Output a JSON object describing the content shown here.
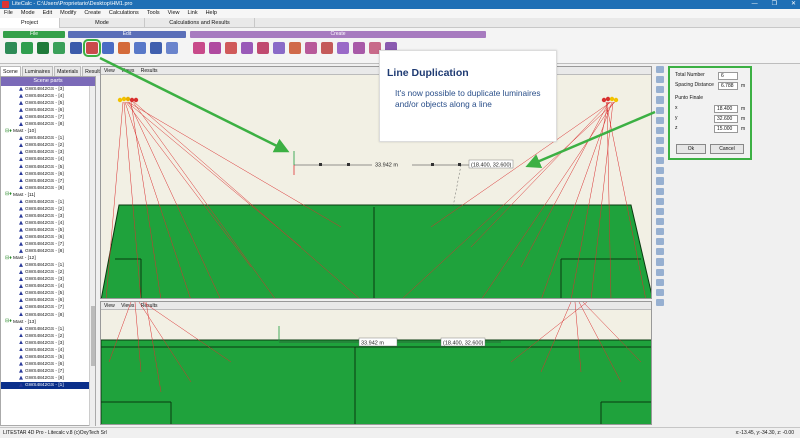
{
  "window": {
    "title": "LiteCalc - C:\\Users\\Proprietario\\Desktop\\HM1.pro",
    "controls": [
      "—",
      "❐",
      "✕"
    ]
  },
  "menu": [
    "File",
    "Mode",
    "Edit",
    "Modify",
    "Create",
    "Calculations",
    "Tools",
    "View",
    "Link",
    "Help"
  ],
  "ribbon_tabs": [
    "Project",
    "Mode",
    "Calculations and Results"
  ],
  "ribbon_groups": {
    "file": "File",
    "edit": "Edit",
    "create": "Create"
  },
  "colors": {
    "file_group": "#34a04a",
    "edit_group": "#5b6fb8",
    "create_group": "#a77bbf",
    "field_green": "#1fa23c",
    "highlight": "#3cb043",
    "callout_text": "#1f3b73"
  },
  "icons": {
    "file": [
      "new-file-icon",
      "open-folder-icon",
      "save-icon",
      "print-icon"
    ],
    "edit": [
      "select-icon",
      "line-duplicate-icon",
      "move-icon",
      "rotate-icon",
      "align-icon",
      "group-icon",
      "ungroup-icon"
    ],
    "create": [
      "luminaire-icon",
      "array-icon",
      "grid-icon",
      "field-icon",
      "mast-icon",
      "light-icon",
      "object-icon",
      "house-icon",
      "calc-grid-icon",
      "sensor-icon",
      "measure-icon",
      "wall-icon",
      "more-icon"
    ]
  },
  "left_tabs": [
    "Scene",
    "Luminaires",
    "Materials",
    "Results"
  ],
  "scene": {
    "header": "Scene parts",
    "items": [
      {
        "type": "lum",
        "label": "GWS4842GS - [3]"
      },
      {
        "type": "lum",
        "label": "GWS4842GS - [4]"
      },
      {
        "type": "lum",
        "label": "GWS4842GS - [5]"
      },
      {
        "type": "lum",
        "label": "GWS4842GS - [6]"
      },
      {
        "type": "lum",
        "label": "GWS4842GS - [7]"
      },
      {
        "type": "lum",
        "label": "GWS4842GS - [8]"
      },
      {
        "type": "mast",
        "label": "Mast - [10]"
      },
      {
        "type": "lum",
        "label": "GWS4842GS - [1]"
      },
      {
        "type": "lum",
        "label": "GWS4842GS - [2]"
      },
      {
        "type": "lum",
        "label": "GWS4842GS - [3]"
      },
      {
        "type": "lum",
        "label": "GWS4842GS - [4]"
      },
      {
        "type": "lum",
        "label": "GWS4842GS - [5]"
      },
      {
        "type": "lum",
        "label": "GWS4842GS - [6]"
      },
      {
        "type": "lum",
        "label": "GWS4842GS - [7]"
      },
      {
        "type": "lum",
        "label": "GWS4842GS - [8]"
      },
      {
        "type": "mast",
        "label": "Mast - [11]"
      },
      {
        "type": "lum",
        "label": "GWS4842GS - [1]"
      },
      {
        "type": "lum",
        "label": "GWS4842GS - [2]"
      },
      {
        "type": "lum",
        "label": "GWS4842GS - [3]"
      },
      {
        "type": "lum",
        "label": "GWS4842GS - [4]"
      },
      {
        "type": "lum",
        "label": "GWS4842GS - [5]"
      },
      {
        "type": "lum",
        "label": "GWS4842GS - [6]"
      },
      {
        "type": "lum",
        "label": "GWS4842GS - [7]"
      },
      {
        "type": "lum",
        "label": "GWS4842GS - [8]"
      },
      {
        "type": "mast",
        "label": "Mast - [12]"
      },
      {
        "type": "lum",
        "label": "GWS4842GS - [1]"
      },
      {
        "type": "lum",
        "label": "GWS4842GS - [2]"
      },
      {
        "type": "lum",
        "label": "GWS4842GS - [3]"
      },
      {
        "type": "lum",
        "label": "GWS4842GS - [4]"
      },
      {
        "type": "lum",
        "label": "GWS4842GS - [5]"
      },
      {
        "type": "lum",
        "label": "GWS4842GS - [6]"
      },
      {
        "type": "lum",
        "label": "GWS4842GS - [7]"
      },
      {
        "type": "lum",
        "label": "GWS4842GS - [8]"
      },
      {
        "type": "mast",
        "label": "Mast - [13]"
      },
      {
        "type": "lum",
        "label": "GWS4842GS - [1]"
      },
      {
        "type": "lum",
        "label": "GWS4842GS - [2]"
      },
      {
        "type": "lum",
        "label": "GWS4842GS - [3]"
      },
      {
        "type": "lum",
        "label": "GWS4842GS - [4]"
      },
      {
        "type": "lum",
        "label": "GWS4842GS - [5]"
      },
      {
        "type": "lum",
        "label": "GWS4842GS - [6]"
      },
      {
        "type": "lum",
        "label": "GWS4842GS - [7]"
      },
      {
        "type": "lum",
        "label": "GWS4842GS - [8]"
      },
      {
        "type": "lum",
        "label": "GWS4842GS - [1]",
        "selected": true
      }
    ]
  },
  "view_tabs": [
    "View",
    "Views",
    "Results"
  ],
  "view1": {
    "measure_label": "33.942 m",
    "coord_label": "(18.400, 32.600)"
  },
  "view2": {
    "measure_label": "33.942 m",
    "coord_label": "(18.400, 32.600)"
  },
  "callout": {
    "title": "Line Duplication",
    "text": "It's now possible to duplicate luminaires and/or objects along a line"
  },
  "dup_panel": {
    "total_number_label": "Total Number",
    "total_number": "6",
    "spacing_label": "Spacing Distance",
    "spacing": "6.788",
    "unit": "m",
    "final_point_label": "Punto Finale",
    "x_label": "x",
    "x": "18.400",
    "y_label": "y",
    "y": "32.600",
    "z_label": "z",
    "z": "15.000",
    "ok": "Ok",
    "cancel": "Cancel"
  },
  "status": {
    "left": "LITESTAR 4D Pro - Litecalc v.8   (c)OxyTech Srl",
    "right": "x:-13.45, y:-34.30, z: -0.00"
  }
}
